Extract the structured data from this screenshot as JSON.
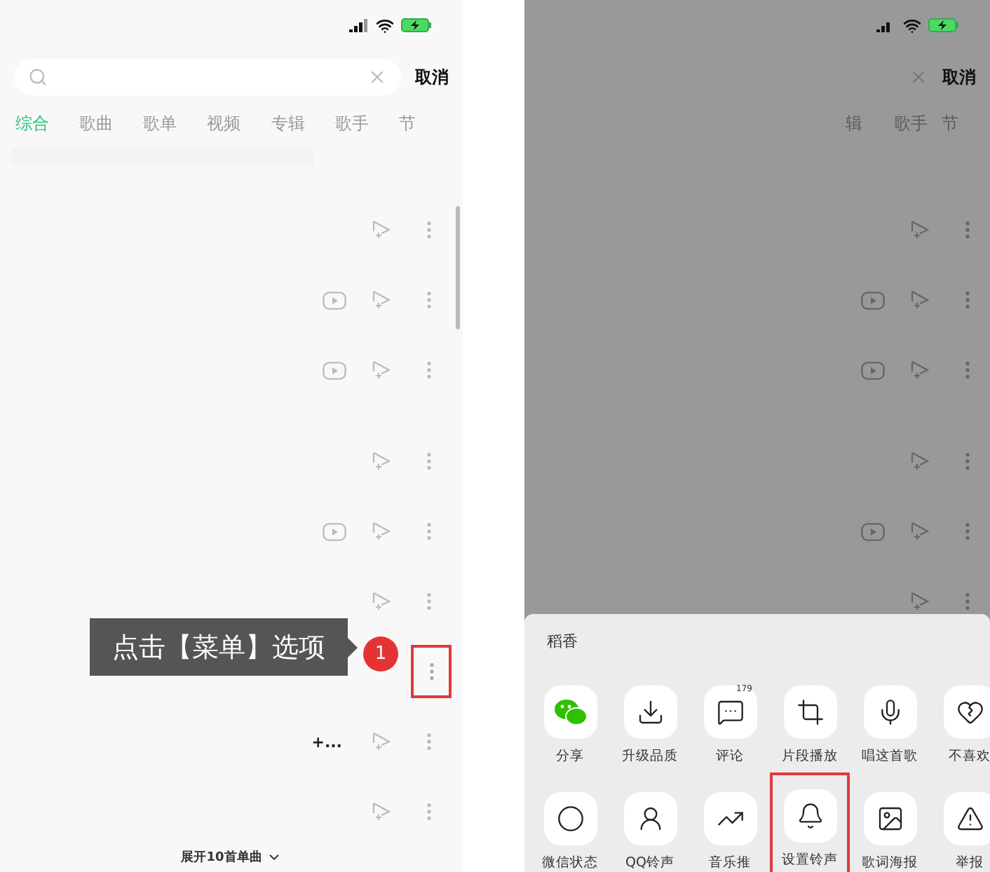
{
  "left": {
    "cancel": "取消",
    "tabs": [
      {
        "label": "综合",
        "selected": true
      },
      {
        "label": "歌曲",
        "selected": false
      },
      {
        "label": "歌单",
        "selected": false
      },
      {
        "label": "视频",
        "selected": false
      },
      {
        "label": "专辑",
        "selected": false
      },
      {
        "label": "歌手",
        "selected": false
      },
      {
        "label": "节",
        "selected": false
      }
    ],
    "rows": [
      {
        "video": false,
        "add": true,
        "highlighted": false
      },
      {
        "video": true,
        "add": true,
        "highlighted": false
      },
      {
        "video": true,
        "add": true,
        "highlighted": false
      },
      {
        "video": false,
        "add": true,
        "highlighted": false
      },
      {
        "video": true,
        "add": true,
        "highlighted": false
      },
      {
        "video": false,
        "add": true,
        "highlighted": false
      },
      {
        "video": false,
        "add": false,
        "highlighted": true
      },
      {
        "video": false,
        "add": true,
        "highlighted": false,
        "note": "+..."
      },
      {
        "video": false,
        "add": true,
        "highlighted": false
      }
    ],
    "tip": {
      "text": "点击【菜单】选项",
      "step": "1"
    },
    "expand": "展开10首单曲"
  },
  "right": {
    "cancel": "取消",
    "tabs": [
      {
        "label": "辑",
        "selected": false
      },
      {
        "label": "歌手",
        "selected": false
      },
      {
        "label": "节",
        "selected": false
      }
    ],
    "rows": [
      {
        "video": false
      },
      {
        "video": true
      },
      {
        "video": true
      },
      {
        "video": false
      },
      {
        "video": true
      },
      {
        "video": false
      }
    ],
    "sheet": {
      "title": "稻香",
      "actions": [
        {
          "kind": "wechat",
          "label": "分享",
          "highlighted": false
        },
        {
          "kind": "upgrade",
          "label": "升级品质",
          "highlighted": false
        },
        {
          "kind": "comment",
          "label": "评论",
          "badge": "179",
          "highlighted": false
        },
        {
          "kind": "clip",
          "label": "片段播放",
          "highlighted": false
        },
        {
          "kind": "sing",
          "label": "唱这首歌",
          "highlighted": false
        },
        {
          "kind": "dislike",
          "label": "不喜欢",
          "highlighted": false
        },
        {
          "kind": "status",
          "label": "微信状态",
          "highlighted": false
        },
        {
          "kind": "ringtone",
          "label": "QQ铃声",
          "highlighted": false
        },
        {
          "kind": "trend",
          "label": "音乐推",
          "highlighted": false
        },
        {
          "kind": "bell",
          "label": "设置铃声",
          "highlighted": true
        },
        {
          "kind": "poster",
          "label": "歌词海报",
          "highlighted": false
        },
        {
          "kind": "report",
          "label": "举报",
          "highlighted": false
        }
      ]
    }
  }
}
